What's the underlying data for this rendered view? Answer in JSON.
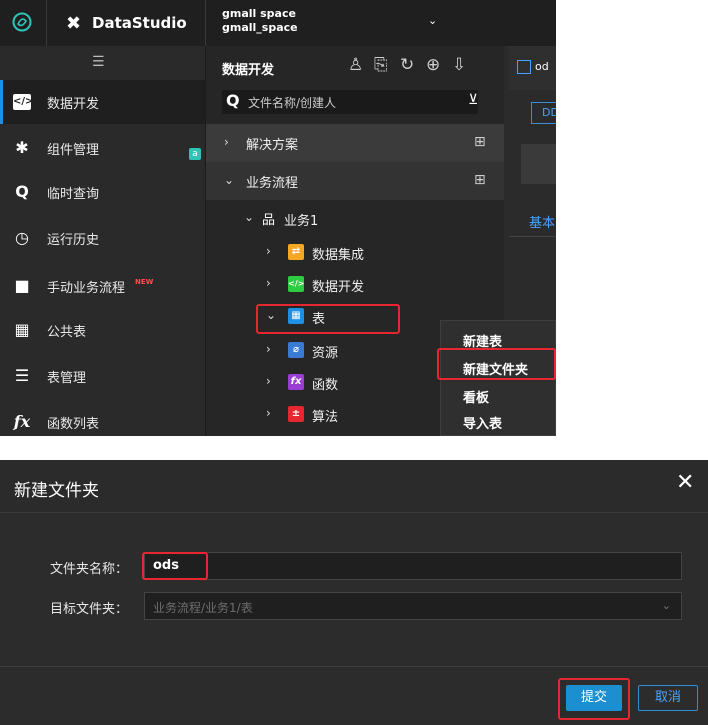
{
  "topbar": {
    "brand": "DataStudio",
    "workspace_line1": "gmall space",
    "workspace_line2": "gmall_space"
  },
  "leftnav": {
    "items": [
      {
        "label": "数据开发",
        "icon": "code-icon",
        "active": true
      },
      {
        "label": "组件管理",
        "icon": "puzzle-icon"
      },
      {
        "label": "临时查询",
        "icon": "search-icon"
      },
      {
        "label": "运行历史",
        "icon": "clock-icon"
      },
      {
        "label": "手动业务流程",
        "icon": "briefcase-icon",
        "badge": "NEW"
      },
      {
        "label": "公共表",
        "icon": "table-icon"
      },
      {
        "label": "表管理",
        "icon": "table-manage-icon"
      },
      {
        "label": "函数列表",
        "icon": "fx-icon"
      }
    ]
  },
  "tree": {
    "title": "数据开发",
    "search_placeholder": "文件名称/创建人",
    "solutions": "解决方案",
    "workflows": "业务流程",
    "business1": "业务1",
    "nodes": [
      {
        "label": "数据集成",
        "icon": "data-integration-icon",
        "color": "#f5a623"
      },
      {
        "label": "数据开发",
        "icon": "code-icon",
        "color": "#2ecc40"
      },
      {
        "label": "表",
        "icon": "table-icon",
        "color": "#1d90e6"
      },
      {
        "label": "资源",
        "icon": "resource-icon",
        "color": "#3a7bd5"
      },
      {
        "label": "函数",
        "icon": "function-icon",
        "color": "#9b3fd4"
      },
      {
        "label": "算法",
        "icon": "algorithm-icon",
        "color": "#e8262f"
      }
    ]
  },
  "rightpane": {
    "tab_label": "od",
    "ddl_label": "DD",
    "basic_tab": "基本"
  },
  "context_menu": {
    "items": [
      "新建表",
      "新建文件夹",
      "看板",
      "导入表"
    ]
  },
  "dialog": {
    "title": "新建文件夹",
    "folder_name_label": "文件夹名称：",
    "folder_name_value": "ods",
    "target_folder_label": "目标文件夹：",
    "target_folder_placeholder": "业务流程/业务1/表",
    "submit": "提交",
    "cancel": "取消"
  },
  "colors": {
    "accent": "#1d90e6",
    "highlight": "#e8262f"
  }
}
